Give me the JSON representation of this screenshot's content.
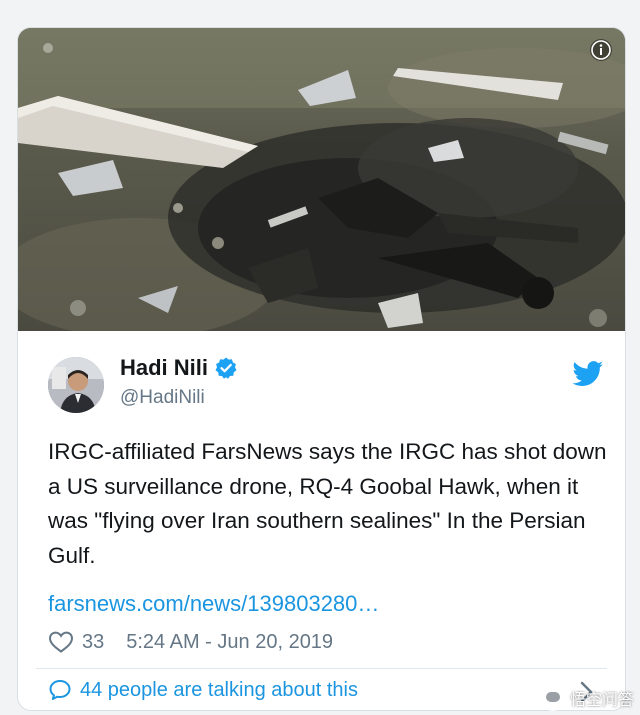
{
  "tweet": {
    "author_name": "Hadi Nili",
    "author_handle": "@HadiNili",
    "text": "IRGC-affiliated FarsNews says the IRGC has shot down a US surveillance drone, RQ-4 Goobal Hawk, when it was \"flying over Iran southern sealines\" In the Persian Gulf.",
    "link_text": "farsnews.com/news/139803280…",
    "likes": "33",
    "timestamp": "5:24 AM - Jun 20, 2019",
    "talking": "44 people are talking about this"
  },
  "watermark": {
    "text": "悟空问答"
  },
  "icons": {
    "info": "info-icon",
    "verified": "verified-badge-icon",
    "brand": "twitter-bird-icon",
    "like": "heart-icon",
    "reply": "chat-bubble-icon",
    "more": "chevron-right-icon"
  },
  "colors": {
    "brand": "#1da1f2",
    "link": "#1b95e0",
    "muted": "#657786",
    "text": "#14171a"
  }
}
